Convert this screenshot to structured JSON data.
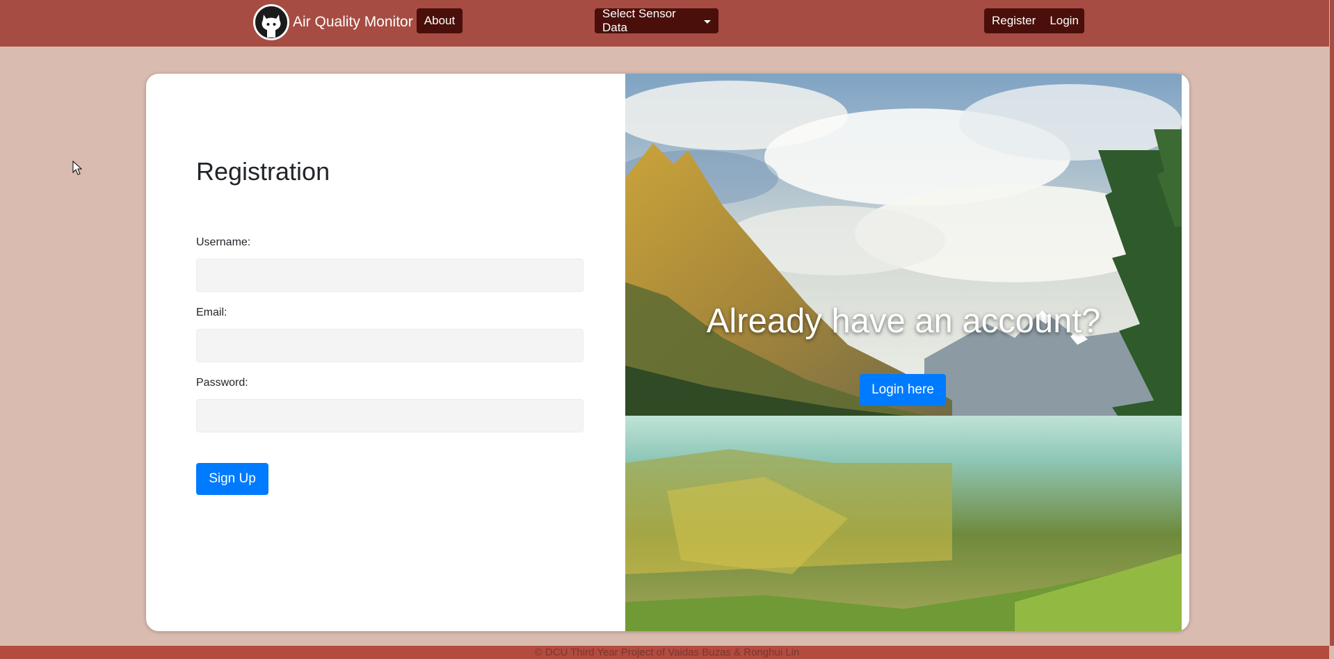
{
  "navbar": {
    "brand_title": "Air Quality Monitor",
    "brand_icon": "github-octocat-icon",
    "about_label": "About",
    "sensor_dropdown_label": "Select Sensor Data",
    "register_label": "Register",
    "login_label": "Login"
  },
  "form": {
    "title": "Registration",
    "username_label": "Username:",
    "email_label": "Email:",
    "password_label": "Password:",
    "username_value": "",
    "email_value": "",
    "password_value": "",
    "submit_label": "Sign Up"
  },
  "hero": {
    "heading": "Already have an account?",
    "button_label": "Login here",
    "image_subject": "mountain-lake-landscape"
  },
  "footer": {
    "text": "© DCU Third Year Project of Vaidas Buzas & Ronghui Lin"
  },
  "colors": {
    "navbar": "#a64c42",
    "nav_button": "#4a0f0a",
    "page_background": "#d9bbaf",
    "primary_button": "#007bff",
    "footer": "#b34c3f"
  }
}
